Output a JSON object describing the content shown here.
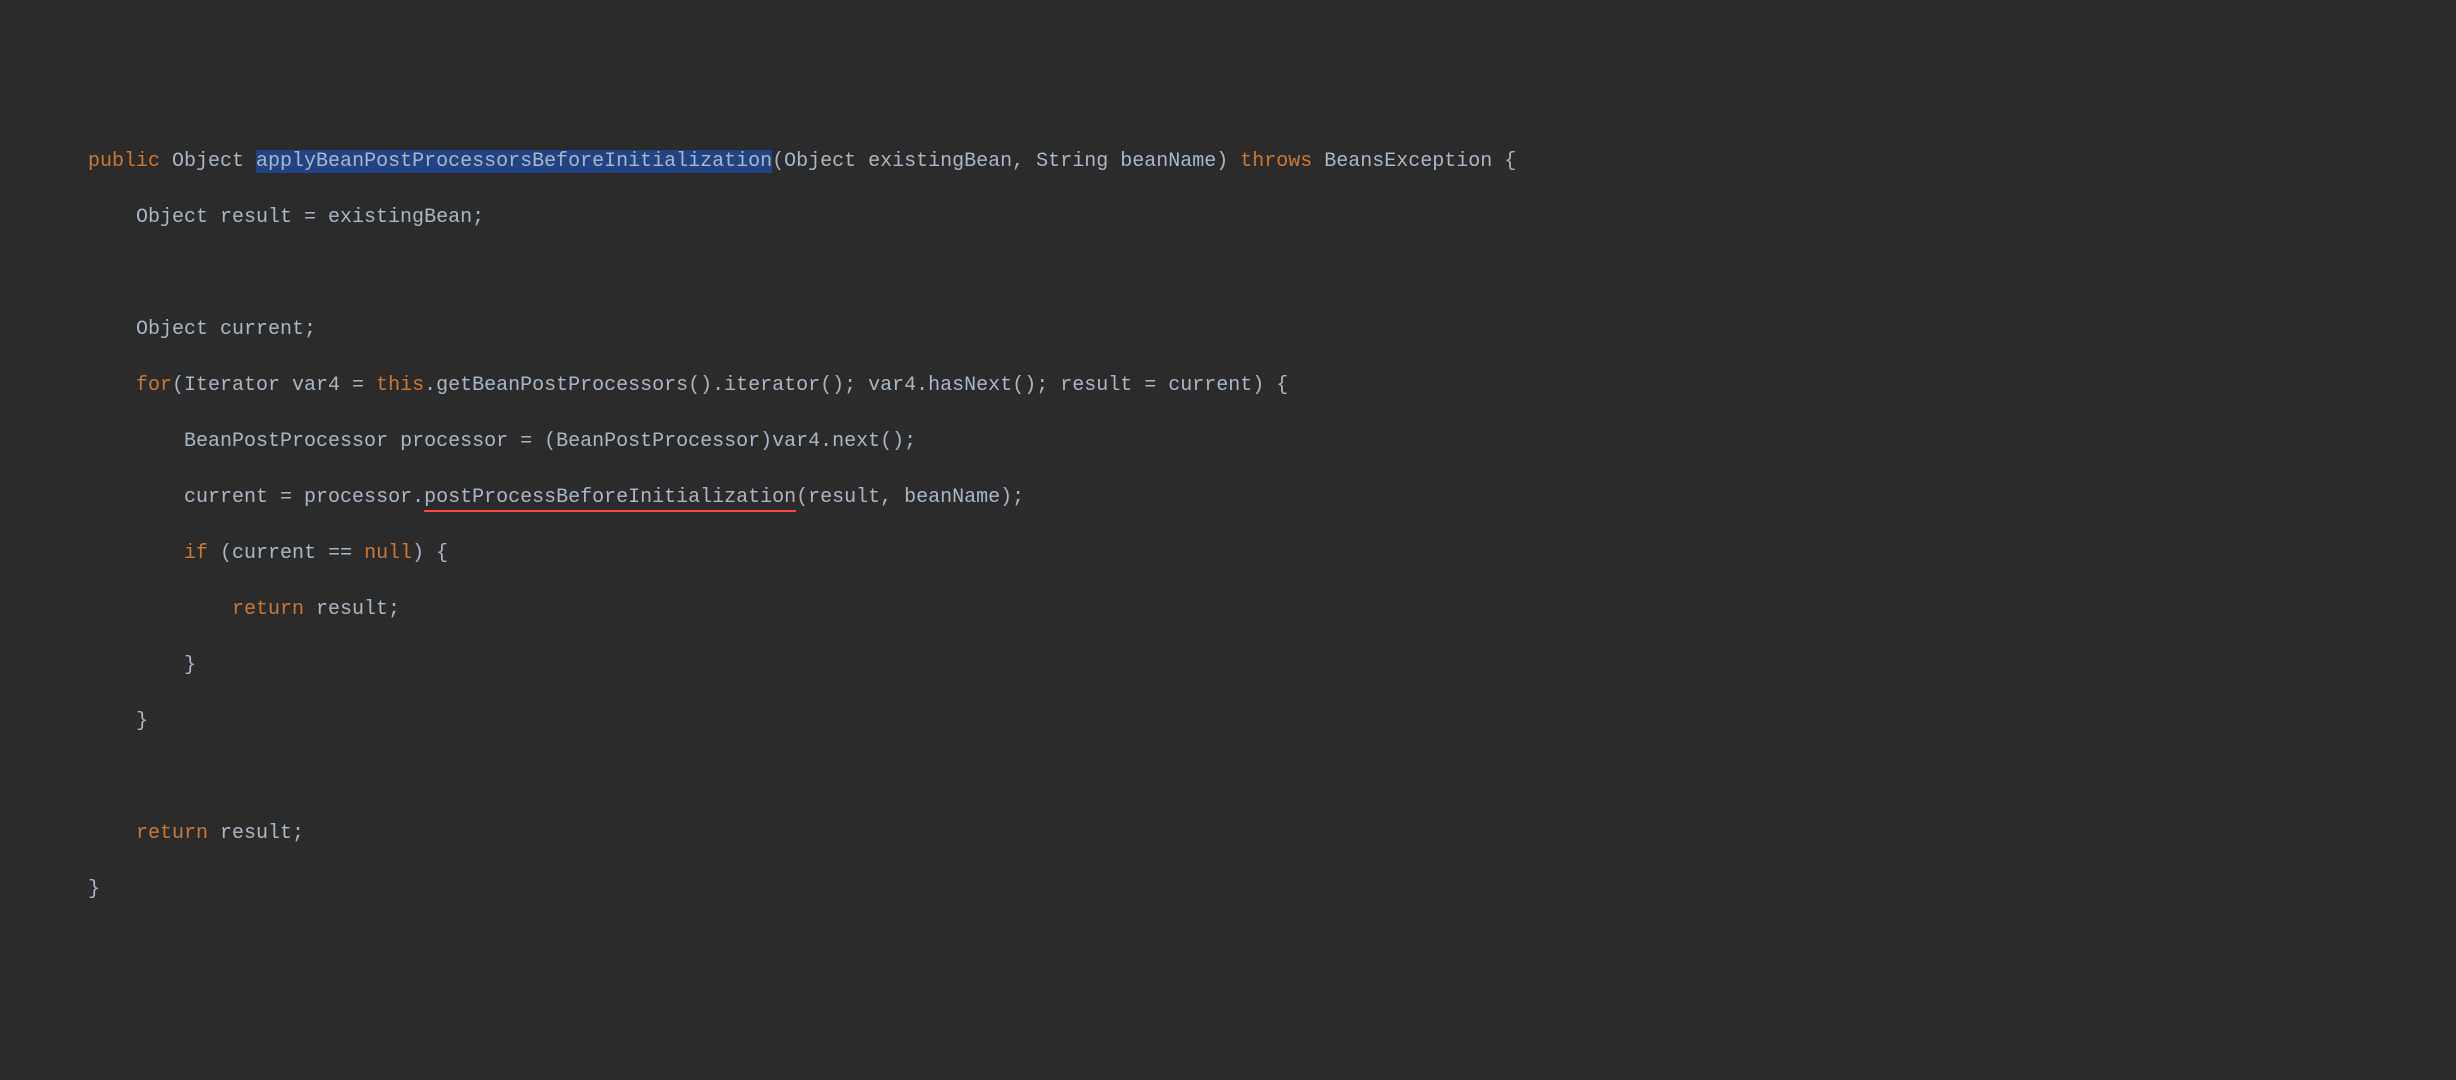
{
  "code": {
    "line1": {
      "kw_public": "public",
      "type1": " Object ",
      "method_name": "applyBeanPostProcessorsBeforeInitialization",
      "params": "(Object existingBean, String beanName) ",
      "kw_throws": "throws",
      "exception": " BeansException {"
    },
    "line2": {
      "indent": "        ",
      "text": "Object result = existingBean;"
    },
    "line3": {
      "indent": "",
      "text": ""
    },
    "line4": {
      "indent": "        ",
      "text": "Object current;"
    },
    "line5": {
      "indent": "        ",
      "kw_for": "for",
      "text1": "(Iterator var4 = ",
      "kw_this": "this",
      "text2": ".getBeanPostProcessors().iterator(); var4.hasNext(); result = current) {"
    },
    "line6": {
      "indent": "            ",
      "text": "BeanPostProcessor processor = (BeanPostProcessor)var4.next();"
    },
    "line7": {
      "indent": "            ",
      "text1": "current = processor.",
      "underlined": "postProcessBeforeInitialization",
      "text2": "(result, beanName);"
    },
    "line8": {
      "indent": "            ",
      "kw_if": "if",
      "text1": " (current == ",
      "kw_null": "null",
      "text2": ") {"
    },
    "line9": {
      "indent": "                ",
      "kw_return": "return",
      "text": " result;"
    },
    "line10": {
      "indent": "            ",
      "text": "}"
    },
    "line11": {
      "indent": "        ",
      "text": "}"
    },
    "line12": {
      "indent": "",
      "text": ""
    },
    "line13": {
      "indent": "        ",
      "kw_return": "return",
      "text": " result;"
    },
    "line14": {
      "indent": "    ",
      "text": "}"
    }
  }
}
